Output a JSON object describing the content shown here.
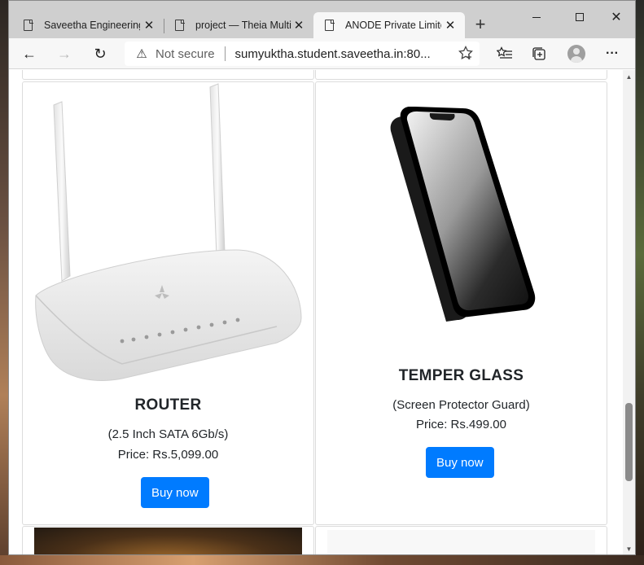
{
  "browser": {
    "tabs": [
      {
        "title": "Saveetha Engineering",
        "active": false
      },
      {
        "title": "project — Theia Multi-",
        "active": false
      },
      {
        "title": "ANODE Private Limited",
        "active": true
      }
    ],
    "new_tab_label": "+",
    "window_controls": {
      "minimize": "minimize",
      "maximize": "maximize",
      "close": "✕"
    },
    "toolbar": {
      "back_icon": "←",
      "forward_icon": "→",
      "reload_icon": "↻",
      "security_icon": "⚠",
      "security_text": "Not secure",
      "url": "sumyuktha.student.saveetha.in:80...",
      "more_label": "···"
    }
  },
  "products": [
    {
      "name": "ROUTER",
      "description": "(2.5 Inch SATA 6Gb/s)",
      "price": "Price: Rs.5,099.00",
      "button_label": "Buy now",
      "image": "wifi-router-image"
    },
    {
      "name": "TEMPER GLASS",
      "description": "(Screen Protector Guard)",
      "price": "Price: Rs.499.00",
      "button_label": "Buy now",
      "image": "phone-screen-protector-image"
    }
  ],
  "colors": {
    "primary_button": "#007bff",
    "text": "#212529",
    "card_border": "#dcdcdc"
  }
}
